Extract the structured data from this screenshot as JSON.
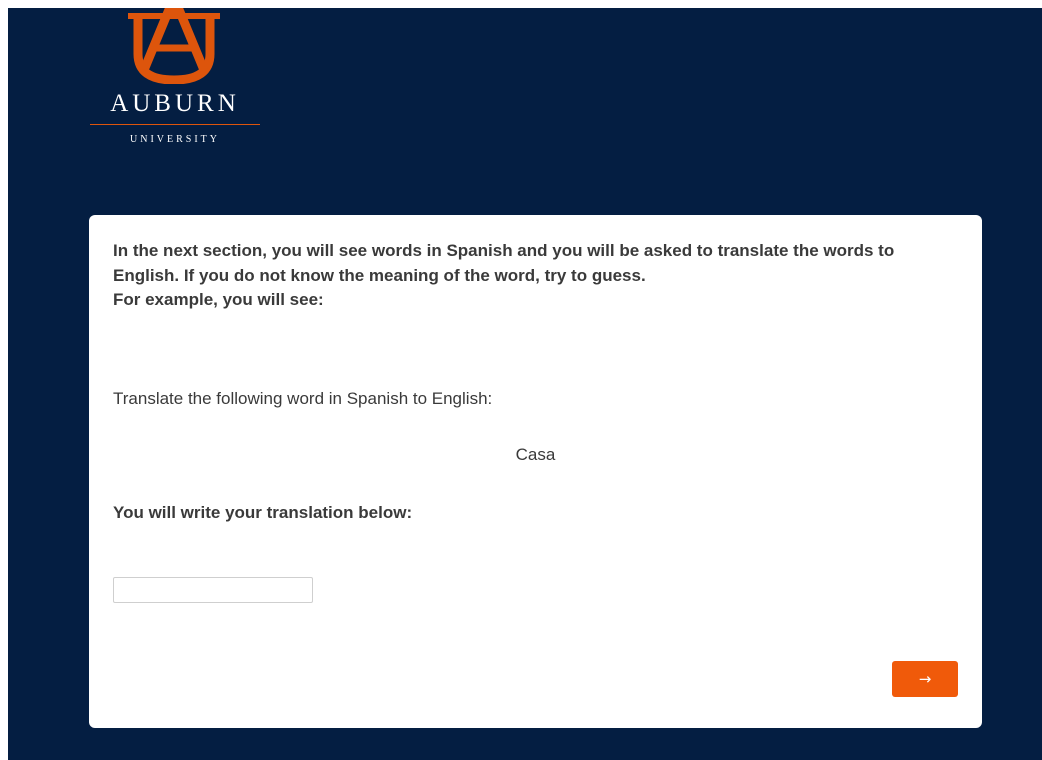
{
  "logo": {
    "name": "AUBURN",
    "subtitle": "UNIVERSITY",
    "colors": {
      "navy": "#041e42",
      "orange": "#dd550c"
    }
  },
  "survey": {
    "intro_line1": "In the next section, you will see words in Spanish and you will be asked to translate the words to English. If you do not know the meaning of the word, try to guess.",
    "intro_line2": "For example, you will see:",
    "prompt": "Translate the following word in Spanish to English:",
    "example_word": "Casa",
    "write_below": "You will write your translation below:",
    "answer": {
      "value": "",
      "placeholder": ""
    },
    "next_button": {
      "label": "→",
      "icon": "arrow-right-icon",
      "color": "#f05a0a"
    }
  }
}
